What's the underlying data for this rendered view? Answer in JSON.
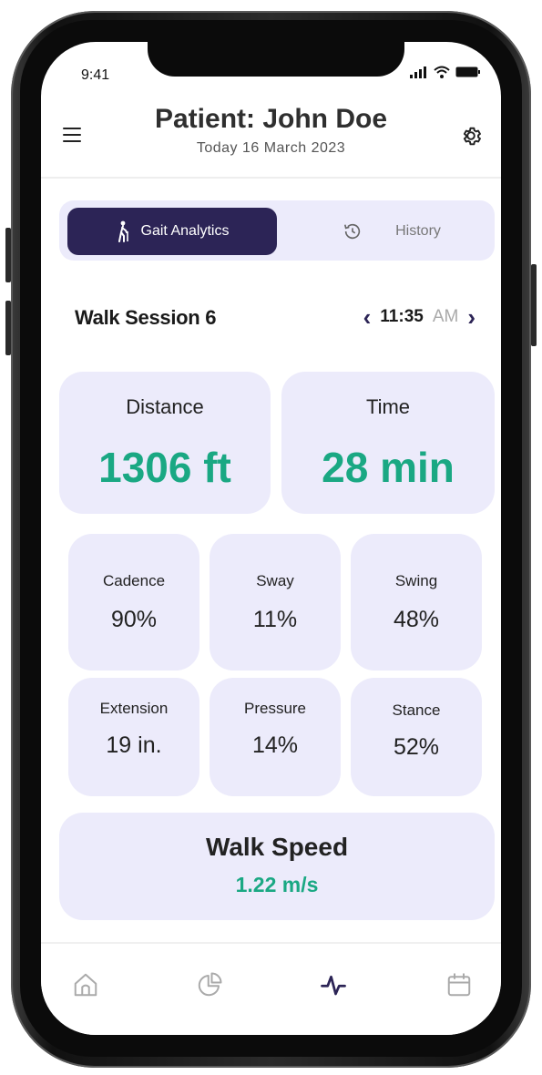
{
  "status": {
    "time": "9:41"
  },
  "header": {
    "title": "Patient: John Doe",
    "subtitle": "Today 16 March 2023"
  },
  "tabs": [
    {
      "label": "Gait Analytics",
      "icon": "walking-cane-icon",
      "active": true
    },
    {
      "label": "History",
      "icon": "history-clock-icon",
      "active": false
    }
  ],
  "session": {
    "title": "Walk Session 6",
    "time": "11:35",
    "ampm": "AM"
  },
  "summary": [
    {
      "label": "Distance",
      "value": "1306 ft"
    },
    {
      "label": "Time",
      "value": "28 min"
    }
  ],
  "metrics": [
    {
      "label": "Cadence",
      "value": "90%"
    },
    {
      "label": "Sway",
      "value": "11%"
    },
    {
      "label": "Swing",
      "value": "48%"
    },
    {
      "label": "Extension",
      "value": "19 in."
    },
    {
      "label": "Pressure",
      "value": "14%"
    },
    {
      "label": "Stance",
      "value": "52%"
    }
  ],
  "walk_speed": {
    "label": "Walk Speed",
    "value": "1.22 m/s"
  },
  "bottom_nav": [
    {
      "icon": "home-icon",
      "active": false
    },
    {
      "icon": "pie-chart-icon",
      "active": false
    },
    {
      "icon": "activity-icon",
      "active": true
    },
    {
      "icon": "calendar-icon",
      "active": false
    }
  ],
  "colors": {
    "accent": "#1aa883",
    "primary": "#2c2456",
    "card": "#ecebfb"
  }
}
